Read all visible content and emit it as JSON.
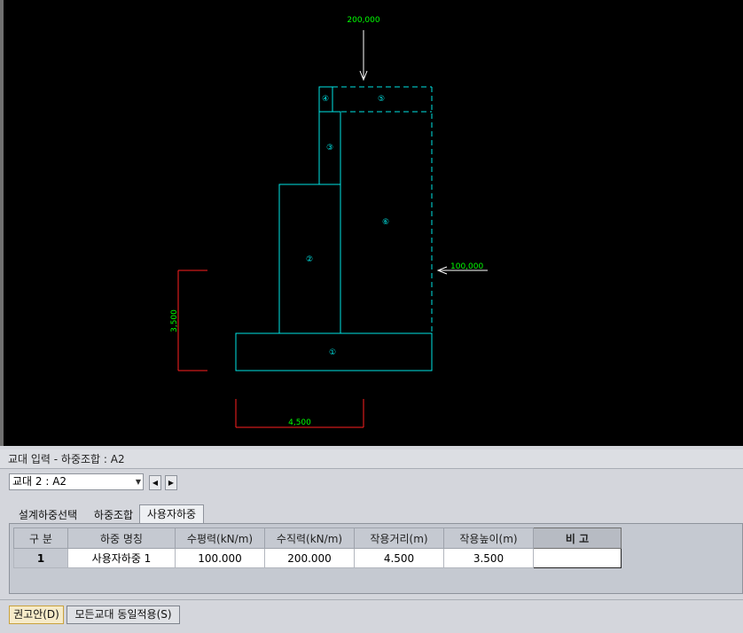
{
  "drawing": {
    "load_top": "200,000",
    "load_side": "100,000",
    "dim_height": "3,500",
    "dim_width": "4,500",
    "parts": [
      "①",
      "②",
      "③",
      "④",
      "⑤",
      "⑥"
    ],
    "colors": {
      "structure": "#00e5e5",
      "load": "#00ff00",
      "dimension": "#ff2020",
      "arrow": "#ffffff"
    }
  },
  "panel": {
    "title": "교대 입력 - 하중조합 : A2",
    "pier_select": "교대 2 : A2",
    "prev_icon": "◀",
    "next_icon": "▶",
    "tabs": [
      "설계하중선택",
      "하중조합",
      "사용자하중"
    ],
    "active_tab": "사용자하중"
  },
  "table": {
    "headers": [
      "구 분",
      "하중 명칭",
      "수평력(kN/m)",
      "수직력(kN/m)",
      "작용거리(m)",
      "작용높이(m)",
      "비 고"
    ],
    "rows": [
      {
        "no": "1",
        "name": "사용자하중 1",
        "horizontal": "100.000",
        "vertical": "200.000",
        "distance": "4.500",
        "height": "3.500",
        "note": ""
      }
    ]
  },
  "buttons": {
    "recommend": "권고안(D)",
    "apply_all": "모든교대 동일적용(S)"
  }
}
